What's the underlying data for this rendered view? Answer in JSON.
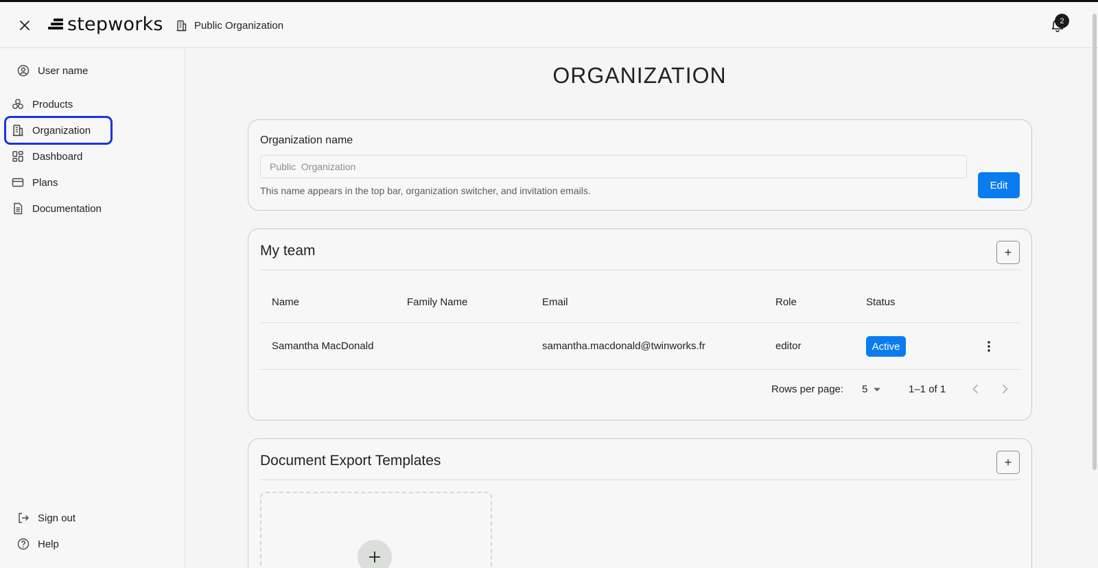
{
  "header": {
    "logo_text": "stepworks",
    "org_name": "Public Organization",
    "notification_count": "2"
  },
  "sidebar": {
    "user_name": "User name",
    "items": [
      {
        "label": "Products",
        "icon": "products-icon"
      },
      {
        "label": "Organization",
        "icon": "building-icon"
      },
      {
        "label": "Dashboard",
        "icon": "dashboard-icon"
      },
      {
        "label": "Plans",
        "icon": "credit-card-icon"
      },
      {
        "label": "Documentation",
        "icon": "document-icon"
      }
    ],
    "sign_out": "Sign out",
    "help": "Help"
  },
  "main": {
    "title": "ORGANIZATION",
    "org_card": {
      "label": "Organization name",
      "input_value": "Public  Organization",
      "helper": "This name appears in the top bar, organization switcher, and invitation emails.",
      "edit_label": "Edit"
    },
    "team_card": {
      "title": "My team",
      "add_label": "+",
      "columns": [
        "Name",
        "Family Name",
        "Email",
        "Role",
        "Status"
      ],
      "rows": [
        {
          "name": "Samantha MacDonald",
          "family_name": "",
          "email": "samantha.macdonald@twinworks.fr",
          "role": "editor",
          "status": "Active"
        }
      ],
      "rows_per_page_label": "Rows per page:",
      "rows_per_page_value": "5",
      "range": "1–1 of 1"
    },
    "templates_card": {
      "title": "Document Export Templates",
      "add_label": "+"
    }
  },
  "colors": {
    "accent": "#0a7cf0",
    "highlight": "#1833e6"
  }
}
